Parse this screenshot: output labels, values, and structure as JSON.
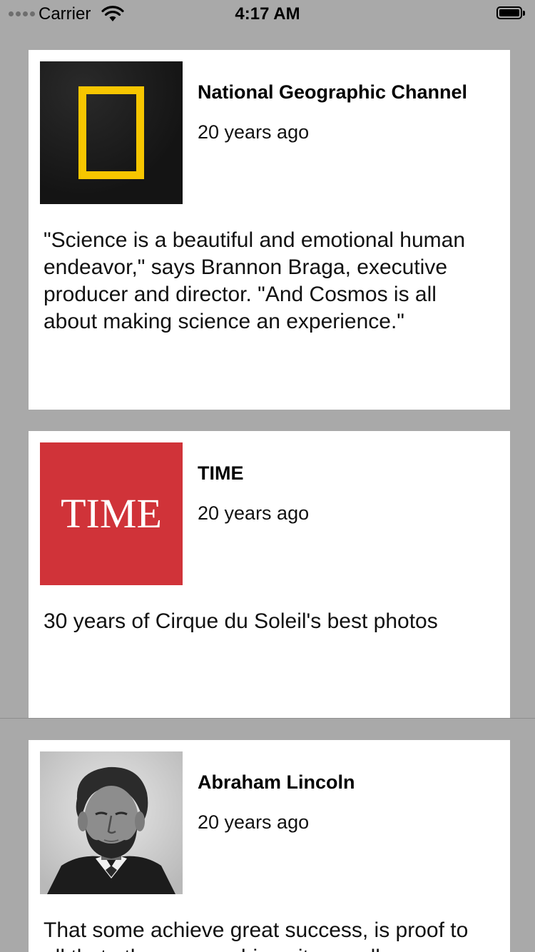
{
  "status_bar": {
    "carrier": "Carrier",
    "time": "4:17 AM"
  },
  "feed": [
    {
      "source": "National Geographic Channel",
      "time_ago": "20 years ago",
      "text": "\"Science is a beautiful and emotional human endeavor,\" says Brannon Braga, executive producer and director. \"And Cosmos is all about making science an experience.\"",
      "thumbnail_icon": "national-geographic-logo"
    },
    {
      "source": "TIME",
      "time_ago": "20 years ago",
      "text": "30 years of Cirque du Soleil's best photos",
      "thumbnail_icon": "time-logo",
      "logo_text": "TIME"
    },
    {
      "source": "Abraham Lincoln",
      "time_ago": "20 years ago",
      "text": "That some achieve great success, is proof to all that others can achieve it as well.",
      "thumbnail_icon": "lincoln-portrait"
    }
  ],
  "colors": {
    "background": "#a9a9a9",
    "card": "#ffffff",
    "natgeo_yellow": "#f7c600",
    "time_red": "#d03339"
  }
}
